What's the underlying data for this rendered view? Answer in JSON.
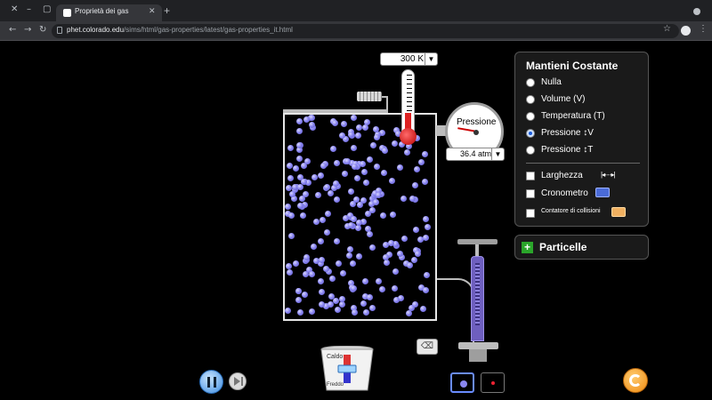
{
  "browser": {
    "tab_title": "Proprietà dei gas",
    "url_domain": "phet.colorado.edu",
    "url_path": "/sims/html/gas-properties/latest/gas-properties_it.html",
    "minimize": "–",
    "restore": "▢",
    "close": "✕",
    "new_tab": "+",
    "back": "←",
    "forward": "→",
    "reload": "↻",
    "star": "☆",
    "menu": "⋮"
  },
  "thermometer": {
    "value": "300 K",
    "dropdown": "▼"
  },
  "pressure": {
    "label": "Pressione",
    "value": "36.4 atm",
    "dropdown": "▼"
  },
  "constant_panel": {
    "title": "Mantieni Costante",
    "options": [
      {
        "label": "Nulla",
        "checked": false
      },
      {
        "label": "Volume (V)",
        "checked": false
      },
      {
        "label": "Temperatura (T)",
        "checked": false
      },
      {
        "label": "Pressione ↕V",
        "checked": true
      },
      {
        "label": "Pressione ↕T",
        "checked": false
      }
    ],
    "checkboxes": [
      {
        "label": "Larghezza",
        "icon": "width-arrows-icon",
        "glyph": "|◂- - -▸|"
      },
      {
        "label": "Cronometro",
        "icon": "stopwatch-icon"
      },
      {
        "label": "Contatore di collisioni",
        "icon": "collision-counter-icon"
      }
    ]
  },
  "particles_panel": {
    "label": "Particelle",
    "plus": "+"
  },
  "bucket": {
    "hot": "Caldo",
    "cold": "Freddo"
  },
  "eraser_glyph": "⌫",
  "colors": {
    "particle": "#7f7bea",
    "panel_bg": "#1a1a1a",
    "accent": "#ef8a10",
    "play": "#3e8de0"
  }
}
